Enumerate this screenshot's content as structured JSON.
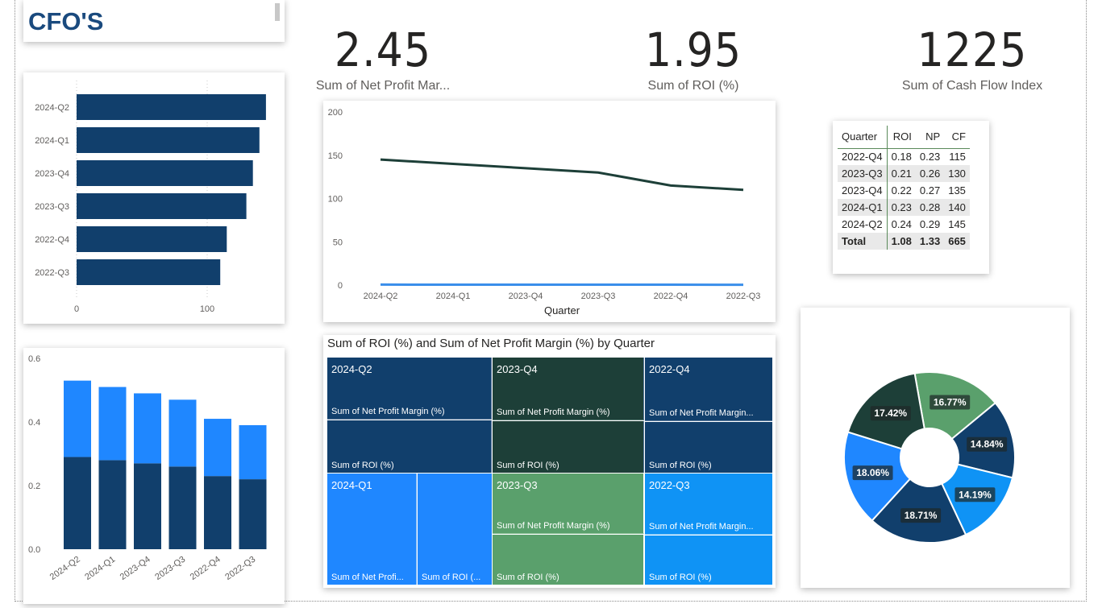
{
  "title": "CFO'S",
  "kpis": [
    {
      "value": "2.45",
      "label": "Sum of Net Profit Mar..."
    },
    {
      "value": "1.95",
      "label": "Sum of ROI (%)"
    },
    {
      "value": "1225",
      "label": "Sum of Cash Flow Index"
    }
  ],
  "colors": {
    "navy": "#113f6c",
    "dark_green": "#1d3f38",
    "green": "#5aa06c",
    "blue": "#1f87ff",
    "light_blue": "#0f93f5",
    "grey_line": "#28b4ff"
  },
  "table": {
    "headers": [
      "Quarter",
      "ROI",
      "NP",
      "CF"
    ],
    "rows": [
      [
        "2022-Q4",
        "0.18",
        "0.23",
        "115"
      ],
      [
        "2023-Q3",
        "0.21",
        "0.26",
        "130"
      ],
      [
        "2023-Q4",
        "0.22",
        "0.27",
        "135"
      ],
      [
        "2024-Q1",
        "0.23",
        "0.28",
        "140"
      ],
      [
        "2024-Q2",
        "0.24",
        "0.29",
        "145"
      ]
    ],
    "total": [
      "Total",
      "1.08",
      "1.33",
      "665"
    ]
  },
  "treemap": {
    "title": "Sum of ROI (%) and Sum of Net Profit Margin (%) by Quarter",
    "groups": [
      {
        "quarter": "2024-Q2",
        "np_label": "Sum of Net Profit Margin (%)",
        "roi_label": "Sum of ROI (%)"
      },
      {
        "quarter": "2023-Q4",
        "np_label": "Sum of Net Profit Margin (%)",
        "roi_label": "Sum of ROI (%)"
      },
      {
        "quarter": "2022-Q4",
        "np_label": "Sum of Net Profit Margin...",
        "roi_label": "Sum of ROI (%)"
      },
      {
        "quarter": "2024-Q1",
        "np_label": "Sum of Net Profi...",
        "roi_label": "Sum of ROI (..."
      },
      {
        "quarter": "2023-Q3",
        "np_label": "Sum of Net Profit Margin (%)",
        "roi_label": "Sum of ROI (%)"
      },
      {
        "quarter": "2022-Q3",
        "np_label": "Sum of Net Profit Margin...",
        "roi_label": "Sum of ROI (%)"
      }
    ]
  },
  "chart_data": [
    {
      "type": "bar",
      "orientation": "horizontal",
      "categories": [
        "2024-Q2",
        "2024-Q1",
        "2023-Q4",
        "2023-Q3",
        "2022-Q4",
        "2022-Q3"
      ],
      "values": [
        145,
        140,
        135,
        130,
        115,
        110
      ],
      "xlim": [
        0,
        145
      ],
      "x_ticks": [
        "0",
        "100"
      ]
    },
    {
      "type": "bar",
      "stacked": true,
      "categories": [
        "2024-Q2",
        "2024-Q1",
        "2023-Q4",
        "2023-Q3",
        "2022-Q4",
        "2022-Q3"
      ],
      "series": [
        {
          "values": [
            0.29,
            0.28,
            0.27,
            0.26,
            0.23,
            0.22
          ]
        },
        {
          "values": [
            0.24,
            0.23,
            0.22,
            0.21,
            0.18,
            0.17
          ]
        }
      ],
      "ylim": [
        0,
        0.6
      ],
      "y_ticks": [
        "0.0",
        "0.2",
        "0.4",
        "0.6"
      ]
    },
    {
      "type": "line",
      "categories": [
        "2024-Q2",
        "2024-Q1",
        "2023-Q4",
        "2023-Q3",
        "2022-Q4",
        "2022-Q3"
      ],
      "series": [
        {
          "values": [
            145,
            140,
            135,
            130,
            115,
            110
          ]
        },
        {
          "values": [
            0.53,
            0.51,
            0.49,
            0.47,
            0.41,
            0.39
          ]
        }
      ],
      "xlabel": "Quarter",
      "ylim": [
        0,
        200
      ],
      "y_ticks": [
        "0",
        "50",
        "100",
        "150",
        "200"
      ]
    },
    {
      "type": "pie",
      "donut": true,
      "slices": [
        {
          "label": "16.77%",
          "value": 16.77,
          "color": "#5aa06c"
        },
        {
          "label": "14.84%",
          "value": 14.84,
          "color": "#113f6c"
        },
        {
          "label": "14.19%",
          "value": 14.19,
          "color": "#0f93f5"
        },
        {
          "label": "18.71%",
          "value": 18.71,
          "color": "#113f6c"
        },
        {
          "label": "18.06%",
          "value": 18.06,
          "color": "#1f87ff"
        },
        {
          "label": "17.42%",
          "value": 17.42,
          "color": "#1d3f38"
        }
      ]
    }
  ]
}
